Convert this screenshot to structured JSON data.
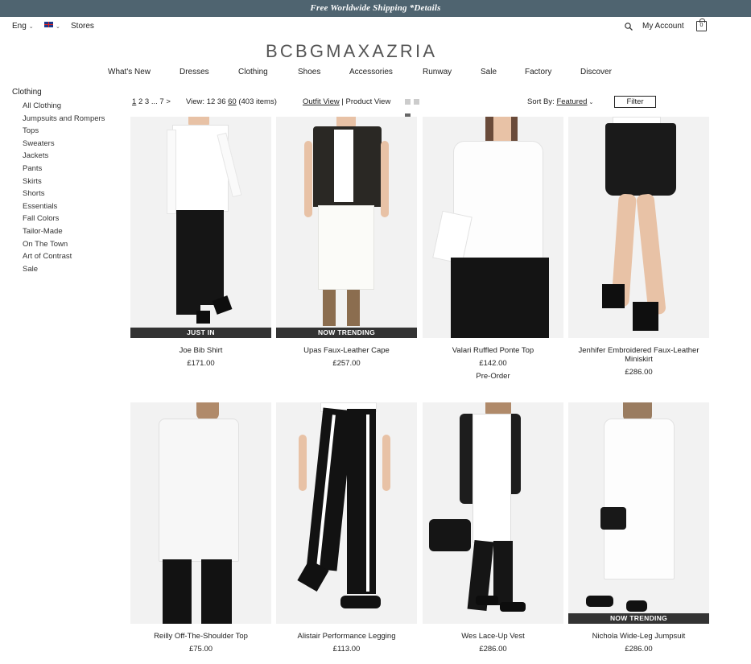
{
  "promo": {
    "text": "Free Worldwide Shipping *Details"
  },
  "header": {
    "language": "Eng",
    "stores": "Stores",
    "account": "My Account",
    "bag_count": "0",
    "logo": "BCBGMAXAZRIA"
  },
  "nav": [
    "What's New",
    "Dresses",
    "Clothing",
    "Shoes",
    "Accessories",
    "Runway",
    "Sale",
    "Factory",
    "Discover"
  ],
  "sidebar": {
    "title": "Clothing",
    "items": [
      "All Clothing",
      "Jumpsuits and Rompers",
      "Tops",
      "Sweaters",
      "Jackets",
      "Pants",
      "Skirts",
      "Shorts",
      "Essentials",
      "Fall Colors",
      "Tailor-Made",
      "On The Town",
      "Art of Contrast",
      "Sale"
    ]
  },
  "toolbar": {
    "pages": [
      "1",
      "2",
      "3",
      "...",
      "7"
    ],
    "next": ">",
    "view_label": "View:",
    "view_options": [
      "12",
      "36",
      "60"
    ],
    "view_selected": "60",
    "item_count": "(403 items)",
    "outfit_view": "Outfit View",
    "separator": "|",
    "product_view": "Product View",
    "sort_label": "Sort By:",
    "sort_value": "Featured",
    "filter": "Filter"
  },
  "products": [
    {
      "name": "Joe Bib Shirt",
      "price": "£171.00",
      "badge": "JUST IN",
      "note": ""
    },
    {
      "name": "Upas Faux-Leather Cape",
      "price": "£257.00",
      "badge": "NOW TRENDING",
      "note": ""
    },
    {
      "name": "Valari Ruffled Ponte Top",
      "price": "£142.00",
      "badge": "",
      "note": "Pre-Order"
    },
    {
      "name": "Jenhifer Embroidered Faux-Leather Miniskirt",
      "price": "£286.00",
      "badge": "",
      "note": ""
    },
    {
      "name": "Reilly Off-The-Shoulder Top",
      "price": "£75.00",
      "badge": "",
      "note": ""
    },
    {
      "name": "Alistair Performance Legging",
      "price": "£113.00",
      "badge": "",
      "note": ""
    },
    {
      "name": "Wes Lace-Up Vest",
      "price": "£286.00",
      "badge": "",
      "note": ""
    },
    {
      "name": "Nichola Wide-Leg Jumpsuit",
      "price": "£286.00",
      "badge": "NOW TRENDING",
      "note": ""
    }
  ],
  "colors": {
    "promo_bar": "#4f6470",
    "badge": "#333333",
    "photo_bg": "#f2f2f2"
  }
}
